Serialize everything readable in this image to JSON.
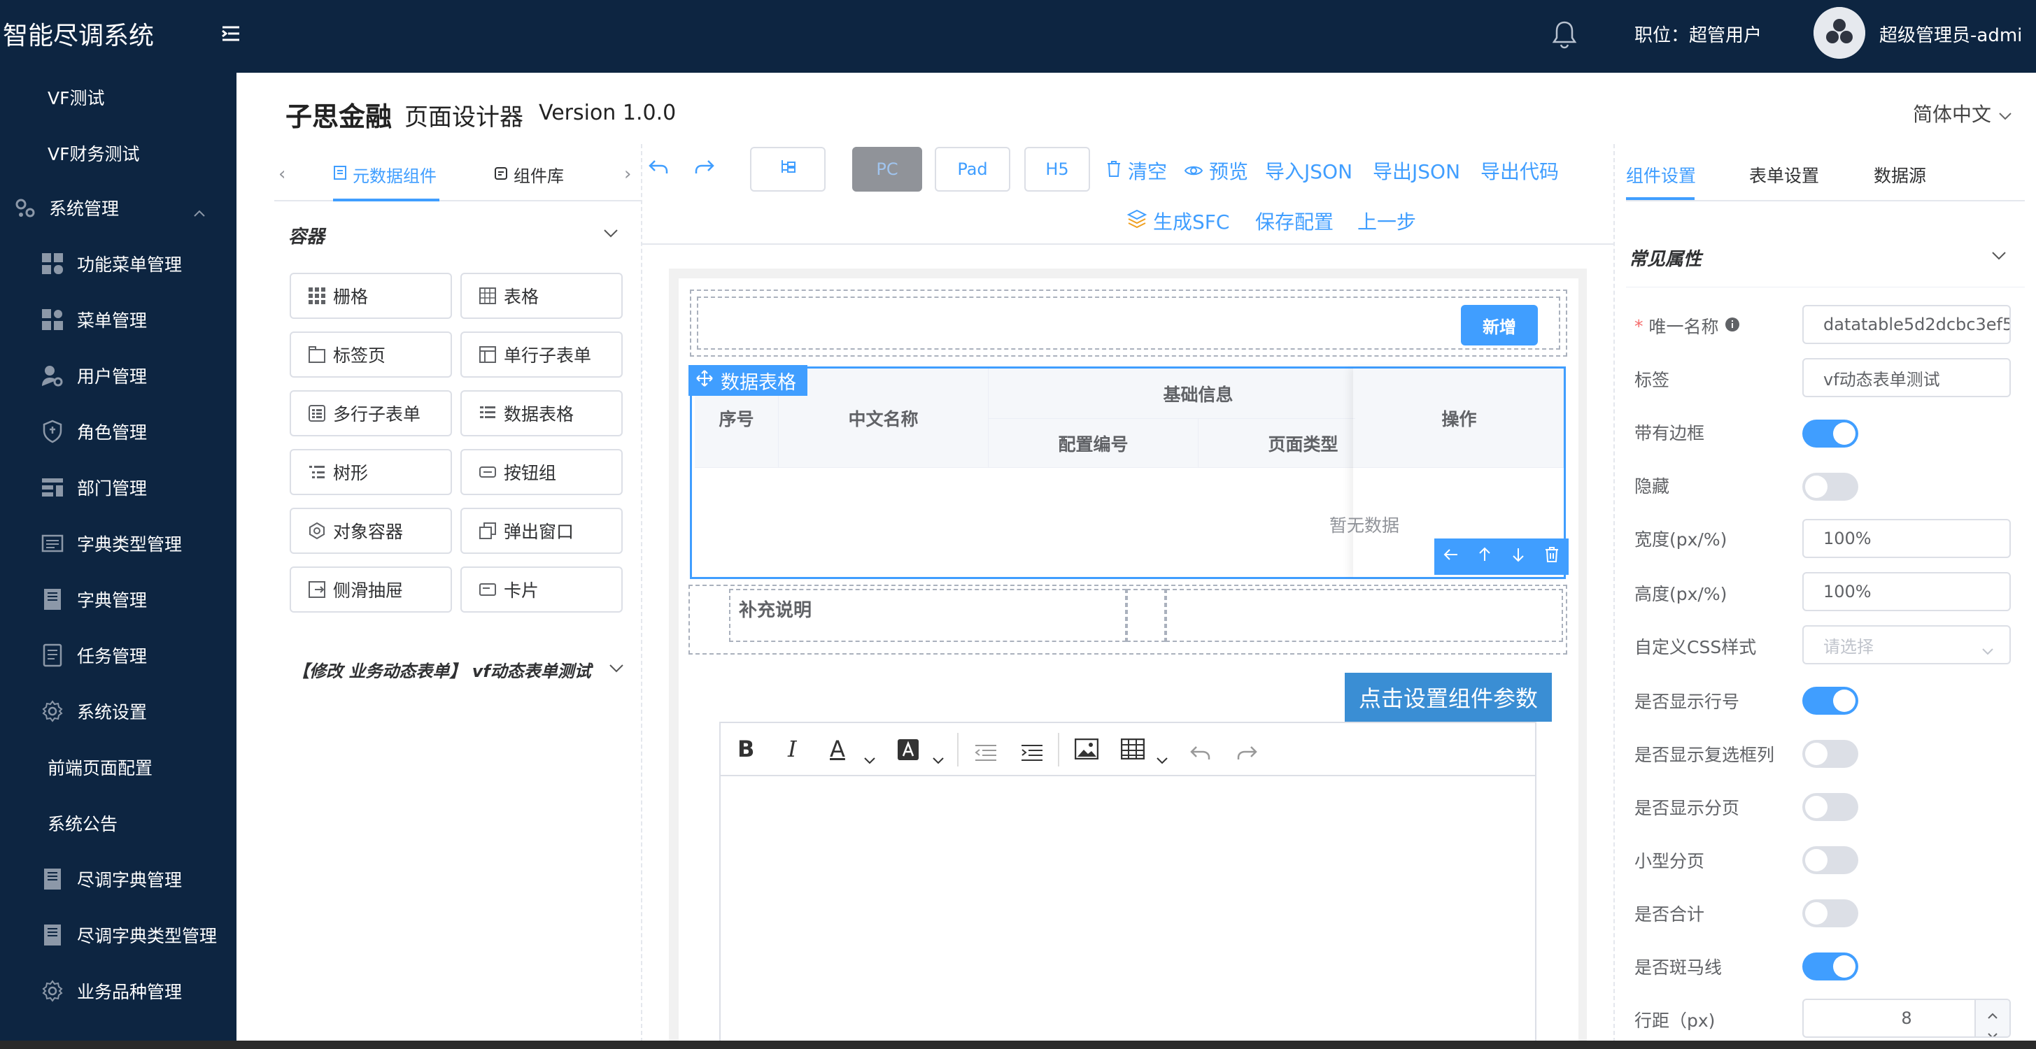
{
  "header": {
    "brand": "智能尽调系统",
    "role_text": "职位：超管用户",
    "user_name": "超级管理员-admi"
  },
  "sidebar": {
    "items": [
      {
        "label": "VF测试",
        "icon": "none"
      },
      {
        "label": "VF财务测试",
        "icon": "none"
      },
      {
        "label": "系统管理",
        "icon": "gears-icon"
      },
      {
        "label": "功能菜单管理",
        "icon": "grid-icon"
      },
      {
        "label": "菜单管理",
        "icon": "menu-grid-icon"
      },
      {
        "label": "用户管理",
        "icon": "user-gear-icon"
      },
      {
        "label": "角色管理",
        "icon": "shield-icon"
      },
      {
        "label": "部门管理",
        "icon": "department-icon"
      },
      {
        "label": "字典类型管理",
        "icon": "list-card-icon"
      },
      {
        "label": "字典管理",
        "icon": "book-icon"
      },
      {
        "label": "任务管理",
        "icon": "document-icon"
      },
      {
        "label": "系统设置",
        "icon": "gear-icon"
      },
      {
        "label": "前端页面配置",
        "icon": "none"
      },
      {
        "label": "系统公告",
        "icon": "none"
      },
      {
        "label": "尽调字典管理",
        "icon": "book-icon"
      },
      {
        "label": "尽调字典类型管理",
        "icon": "book-icon"
      },
      {
        "label": "业务品种管理",
        "icon": "gear-icon"
      }
    ]
  },
  "page": {
    "title": "子思金融",
    "subtitle": "页面设计器",
    "version": "Version 1.0.0",
    "language": "简体中文"
  },
  "left_panel": {
    "tabs": [
      "元数据组件",
      "组件库"
    ],
    "section_title": "容器",
    "components": [
      "栅格",
      "表格",
      "标签页",
      "单行子表单",
      "多行子表单",
      "数据表格",
      "树形",
      "按钮组",
      "对象容器",
      "弹出窗口",
      "侧滑抽屉",
      "卡片"
    ],
    "form_section": "【修改 业务动态表单】 vf动态表单测试"
  },
  "toolbar": {
    "devices": [
      "PC",
      "Pad",
      "H5"
    ],
    "actions_row1": [
      "清空",
      "预览",
      "导入JSON",
      "导出JSON",
      "导出代码"
    ],
    "actions_row2": [
      "生成SFC",
      "保存配置",
      "上一步"
    ]
  },
  "canvas": {
    "add_button": "新增",
    "datatable_tag": "数据表格",
    "headers": {
      "index": "序号",
      "cn_name": "中文名称",
      "basic_info": "基础信息",
      "config_no": "配置编号",
      "page_type": "页面类型",
      "operation": "操作"
    },
    "empty_text": "暂无数据",
    "note_label": "补充说明",
    "set_params_button": "点击设置组件参数"
  },
  "right_panel": {
    "tabs": [
      "组件设置",
      "表单设置",
      "数据源"
    ],
    "section": "常见属性",
    "props": {
      "unique_name_label": "唯一名称",
      "unique_name_value": "datatable5d2dcbc3ef5",
      "tag_label": "标签",
      "tag_value": "vf动态表单测试",
      "border_label": "带有边框",
      "hidden_label": "隐藏",
      "width_label": "宽度(px/%)",
      "width_value": "100%",
      "height_label": "高度(px/%)",
      "height_value": "100%",
      "css_label": "自定义CSS样式",
      "css_placeholder": "请选择",
      "show_row_no_label": "是否显示行号",
      "show_checkbox_label": "是否显示复选框列",
      "show_pagination_label": "是否显示分页",
      "small_pagination_label": "小型分页",
      "sum_label": "是否合计",
      "stripe_label": "是否斑马线",
      "row_gap_label": "行距（px)",
      "row_gap_value": "8"
    },
    "toggles": {
      "border": true,
      "hidden": false,
      "show_row_no": true,
      "show_checkbox": false,
      "show_pagination": false,
      "small_pagination": false,
      "sum": false,
      "stripe": true
    }
  },
  "colors": {
    "nav_bg": "#0d2541",
    "accent": "#409eff"
  }
}
